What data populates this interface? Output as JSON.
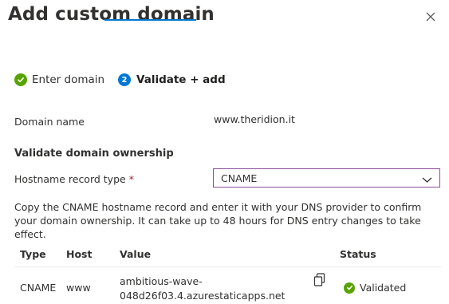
{
  "dialog": {
    "title": "Add custom domain",
    "close_icon": "close-icon"
  },
  "steps": [
    {
      "label": "Enter domain",
      "state": "completed",
      "icon": "checkmark-circle-icon"
    },
    {
      "label": "Validate + add",
      "state": "active",
      "number": "2"
    }
  ],
  "domain": {
    "label": "Domain name",
    "value": "www.theridion.it"
  },
  "validation": {
    "section_title": "Validate domain ownership",
    "record_type_label": "Hostname record type",
    "required_marker": "*",
    "record_type_value": "CNAME",
    "description": "Copy the CNAME hostname record and enter it with your DNS provider to confirm your domain ownership. It can take up to 48 hours for DNS entry changes to take effect."
  },
  "table": {
    "headers": [
      "Type",
      "Host",
      "Value",
      "Status"
    ],
    "rows": [
      {
        "type": "CNAME",
        "host": "www",
        "value_line1": "ambitious-wave-",
        "value_line2": "048d26f03.4.azurestaticapps.net",
        "status": "Validated",
        "copy_icon": "copy-icon",
        "status_icon": "checkmark-circle-icon"
      }
    ]
  },
  "colors": {
    "accent": "#0078d4",
    "success": "#57a300",
    "dropdown_border": "#8a4d9d",
    "required": "#a4262c"
  }
}
